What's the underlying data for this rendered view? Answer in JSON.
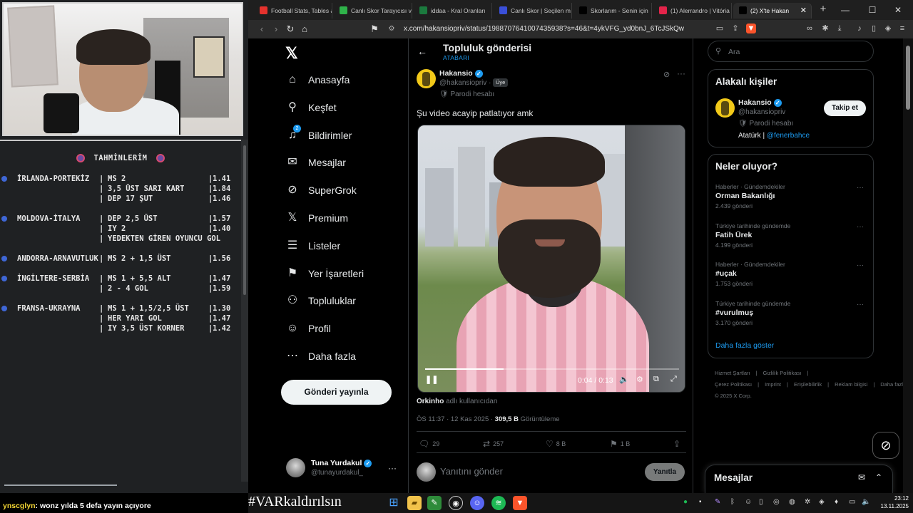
{
  "overlay": {
    "bets_title": "TAHMİNLERİM",
    "bets": [
      {
        "match": "İRLANDA-PORTEKİZ",
        "picks": [
          {
            "pick": "MS 2",
            "odd": "1.41"
          },
          {
            "pick": "3,5 ÜST SARI KART",
            "odd": "1.84"
          },
          {
            "pick": "DEP 17 ŞUT",
            "odd": "1.46"
          }
        ]
      },
      {
        "match": "MOLDOVA-İTALYA",
        "picks": [
          {
            "pick": "DEP 2,5 ÜST",
            "odd": "1.57"
          },
          {
            "pick": "IY 2",
            "odd": "1.40"
          },
          {
            "pick": "YEDEKTEN GİREN OYUNCU GOL",
            "odd": ""
          }
        ]
      },
      {
        "match": "ANDORRA-ARNAVUTLUK",
        "picks": [
          {
            "pick": "MS 2 + 1,5 ÜST",
            "odd": "1.56"
          }
        ]
      },
      {
        "match": "İNGİLTERE-SERBİA",
        "picks": [
          {
            "pick": "MS 1 + 5,5 ALT",
            "odd": "1.47"
          },
          {
            "pick": "2 - 4 GOL",
            "odd": "1.59"
          }
        ]
      },
      {
        "match": "FRANSA-UKRAYNA",
        "picks": [
          {
            "pick": "MS 1 + 1,5/2,5 ÜST",
            "odd": "1.30"
          },
          {
            "pick": "HER YARI GOL",
            "odd": "1.47"
          },
          {
            "pick": "IY 3,5 ÜST KORNER",
            "odd": "1.42"
          }
        ]
      }
    ],
    "chat_user": "ynscglyn",
    "chat_text": ": wonz yılda 5 defa yayın açıyore",
    "hashtag": "#VARkaldırılsın"
  },
  "browser": {
    "tabs": [
      {
        "label": "Football Stats, Tables &",
        "color": "#e5322d"
      },
      {
        "label": "Canlı Skor Tarayıcısı ve",
        "color": "#2fb34a"
      },
      {
        "label": "iddaa - Kral Oranları",
        "color": "#1b7a3e"
      },
      {
        "label": "Canlı Skor | Seçilen m",
        "color": "#3a4fd8"
      },
      {
        "label": "Skorlarım - Senin için",
        "color": "#000000"
      },
      {
        "label": "(1) Alerrandro | Vitória",
        "color": "#e3244a"
      },
      {
        "label": "(2) X'te Hakan",
        "color": "#000000"
      }
    ],
    "url": "x.com/hakansiopriv/status/1988707641007435938?s=46&t=4ykVFG_yd0bnJ_6TcJSkQw"
  },
  "nav": {
    "items": [
      {
        "label": "Anasayfa",
        "icon": "home-icon",
        "glyph": "⌂"
      },
      {
        "label": "Keşfet",
        "icon": "search-icon",
        "glyph": "⚲"
      },
      {
        "label": "Bildirimler",
        "icon": "bell-icon",
        "glyph": "♫",
        "badge": "2"
      },
      {
        "label": "Mesajlar",
        "icon": "mail-icon",
        "glyph": "✉"
      },
      {
        "label": "SuperGrok",
        "icon": "grok-icon",
        "glyph": "⊘"
      },
      {
        "label": "Premium",
        "icon": "x-premium-icon",
        "glyph": "𝕏"
      },
      {
        "label": "Listeler",
        "icon": "list-icon",
        "glyph": "☰"
      },
      {
        "label": "Yer İşaretleri",
        "icon": "bookmark-icon",
        "glyph": "⚑"
      },
      {
        "label": "Topluluklar",
        "icon": "communities-icon",
        "glyph": "⚇"
      },
      {
        "label": "Profil",
        "icon": "profile-icon",
        "glyph": "☺"
      },
      {
        "label": "Daha fazla",
        "icon": "more-icon",
        "glyph": "⋯"
      }
    ],
    "post_button": "Gönderi yayınla",
    "me_name": "Tuna Yurdakul",
    "me_handle": "@tunayurdakul_"
  },
  "post": {
    "header_title": "Topluluk gönderisi",
    "header_sub": "ATABARI",
    "author": "Hakansio",
    "handle": "@hakansiopriv",
    "member_badge": "Üye",
    "parody_label": "Parodi hesabı",
    "text": "Şu video acayip patlatıyor amk",
    "video_time": "0:04 / 0:13",
    "video_progress": 0.31,
    "attrib_name": "Orkinho",
    "attrib_rest": " adlı kullanıcıdan",
    "timestamp": "ÖS 11:37 · 12 Kas 2025 · ",
    "views": "309,5 B",
    "views_label": " Görüntüleme",
    "replies": "29",
    "reposts": "257",
    "likes": "8 B",
    "bookmarks": "1 B",
    "reply_placeholder": "Yanıtını gönder",
    "reply_button": "Yanıtla"
  },
  "sidebar": {
    "search_placeholder": "Ara",
    "related_title": "Alakalı kişiler",
    "related": {
      "name": "Hakansio",
      "handle": "@hakansiopriv",
      "parody": "Parodi hesabı",
      "bio_text": "Atatürk | ",
      "bio_link": "@fenerbahce",
      "follow": "Takip et"
    },
    "trends_title": "Neler oluyor?",
    "trends": [
      {
        "context": "Haberler · Gündemdekiler",
        "name": "Orman Bakanlığı",
        "count": "2.439 gönderi"
      },
      {
        "context": "Türkiye tarihinde gündemde",
        "name": "Fatih Ürek",
        "count": "4.199 gönderi"
      },
      {
        "context": "Haberler · Gündemdekiler",
        "name": "#uçak",
        "count": "1.753 gönderi"
      },
      {
        "context": "Türkiye tarihinde gündemde",
        "name": "#vurulmuş",
        "count": "3.170 gönderi"
      }
    ],
    "show_more": "Daha fazla göster",
    "footer": [
      "Hizmet Şartları",
      "|",
      "Gizlilik Politikası",
      "|",
      "Çerez Politikası",
      "|",
      "Imprint",
      "|",
      "Erişilebilirlik",
      "|",
      "Reklam bilgisi",
      "|",
      "Daha fazla ···",
      "© 2025 X Corp."
    ],
    "messages_title": "Mesajlar"
  },
  "taskbar": {
    "time": "23:12",
    "date": "13.11.2025"
  }
}
